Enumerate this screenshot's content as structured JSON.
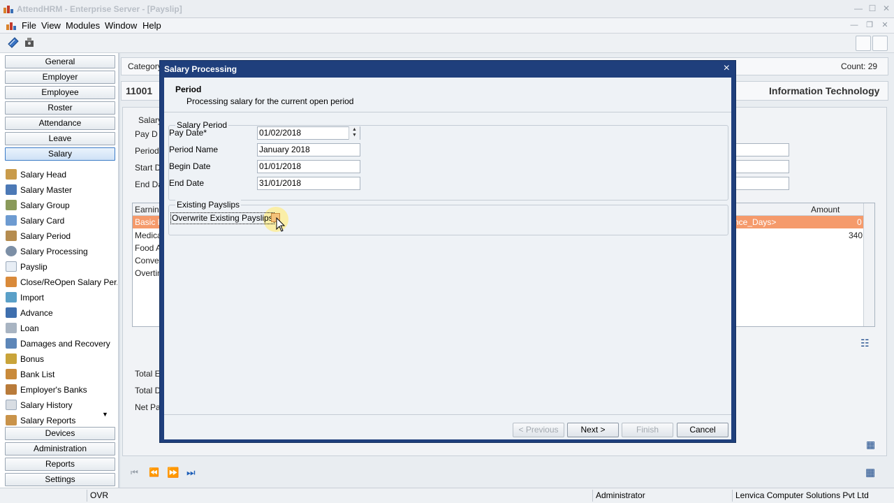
{
  "window": {
    "title": "AttendHRM - Enterprise Server - [Payslip]"
  },
  "menu": [
    "File",
    "View",
    "Modules",
    "Window",
    "Help"
  ],
  "nav": {
    "sections_top": [
      "General",
      "Employer",
      "Employee",
      "Roster",
      "Attendance",
      "Leave",
      "Salary"
    ],
    "salary_items": [
      "Salary Head",
      "Salary Master",
      "Salary Group",
      "Salary Card",
      "Salary Period",
      "Salary Processing",
      "Payslip",
      "Close/ReOpen Salary Per...",
      "Import",
      "Advance",
      "Loan",
      "Damages and Recovery",
      "Bonus",
      "Bank List",
      "Employer's Banks",
      "Salary History",
      "Salary Reports"
    ],
    "sections_bottom": [
      "Devices",
      "Administration",
      "Reports",
      "Settings"
    ]
  },
  "background": {
    "category_label": "Category",
    "count": "Count: 29",
    "emp_code": "11001",
    "department": "Information Technology",
    "salary_label": "Salary",
    "pay_label": "Pay D",
    "period_label": "Period",
    "start_label": "Start D",
    "end_label": "End Da",
    "grid_header": "Earning",
    "grid_amount": "Amount",
    "rows": [
      "Basic P",
      "Medica",
      "Food A",
      "Convey",
      "Overtim"
    ],
    "row_formula": "nce_Days>",
    "row_amount_1": "0",
    "row_amount_2": "340",
    "totals": [
      "Total E",
      "Total D",
      "Net Pa"
    ]
  },
  "dialog": {
    "title": "Salary Processing",
    "step_title": "Period",
    "step_subtitle": "Processing salary for the current open period",
    "salary_period_group": "Salary Period",
    "pay_date_label": "Pay Date*",
    "pay_date": "01/02/2018",
    "period_name_label": "Period Name",
    "period_name": "January 2018",
    "begin_date_label": "Begin Date",
    "begin_date": "01/01/2018",
    "end_date_label": "End Date",
    "end_date": "31/01/2018",
    "existing_group": "Existing Payslips",
    "overwrite_label": "Overwrite Existing Payslips",
    "buttons": {
      "previous": "< Previous",
      "next": "Next >",
      "finish": "Finish",
      "cancel": "Cancel"
    }
  },
  "status": {
    "mode": "OVR",
    "user": "Administrator",
    "company": "Lenvica Computer Solutions Pvt Ltd"
  },
  "colors": {
    "dialog_title_bg": "#1f3f7c",
    "grid_selection": "#f59a6b",
    "active_nav": "#3b7bc6"
  }
}
